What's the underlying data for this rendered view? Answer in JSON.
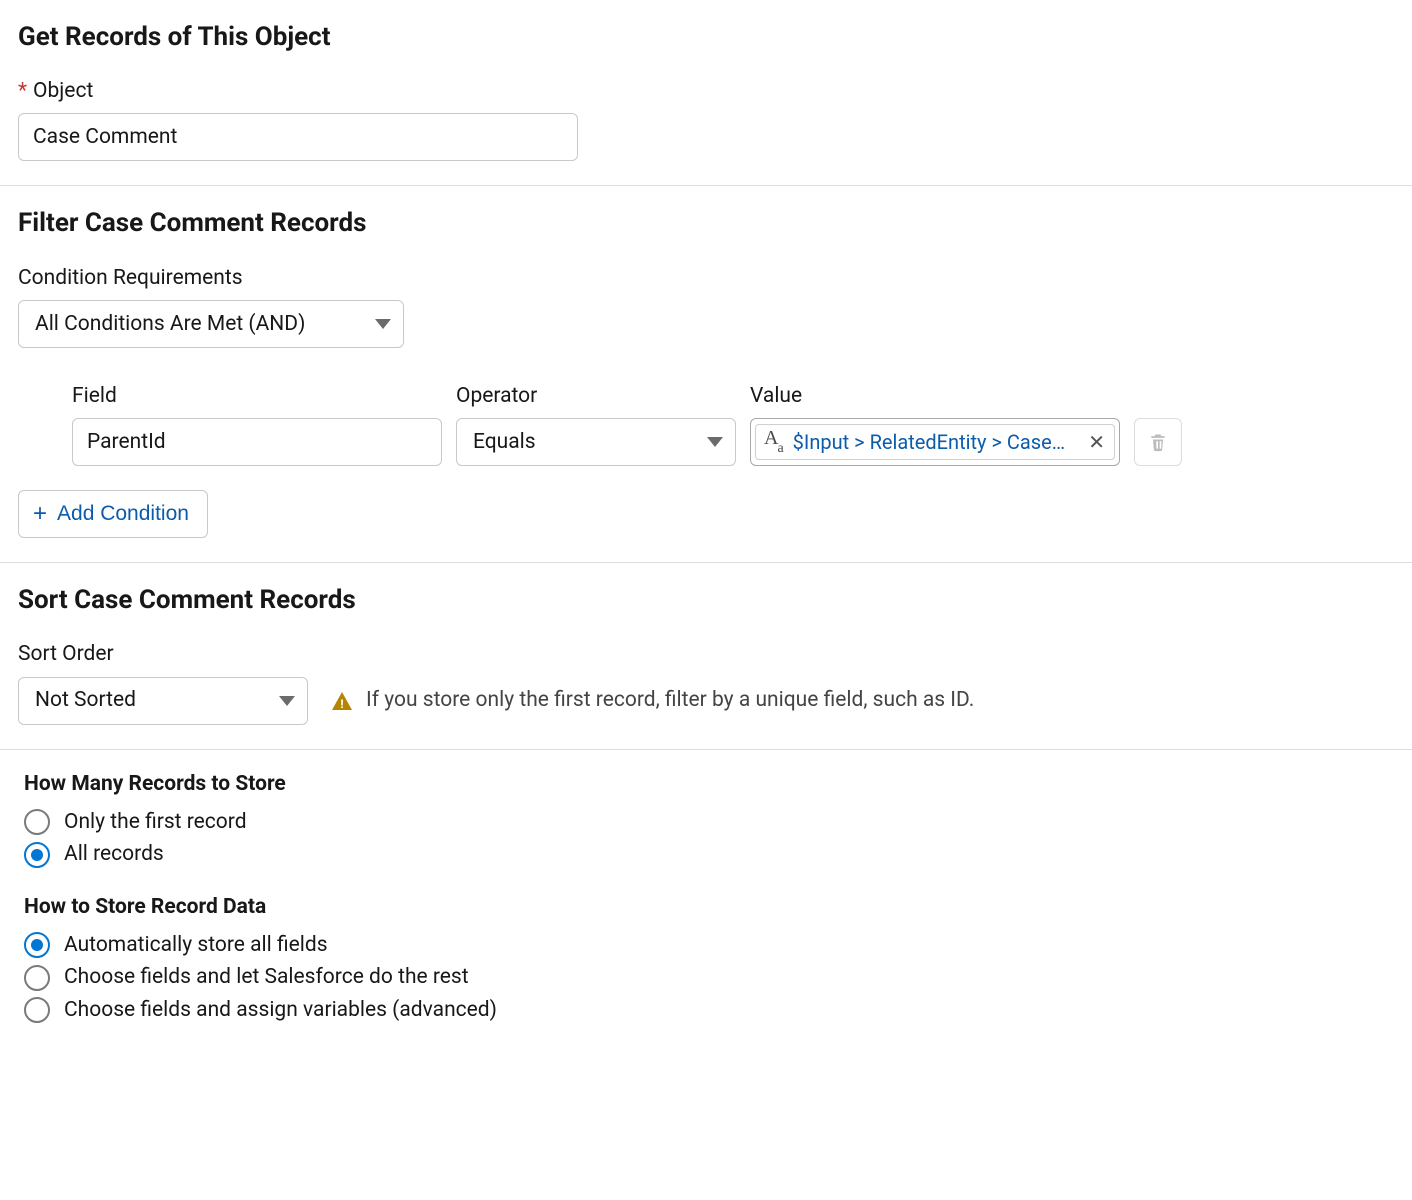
{
  "get_records": {
    "title": "Get Records of This Object",
    "object_label": "Object",
    "object_value": "Case Comment"
  },
  "filter": {
    "title": "Filter Case Comment Records",
    "cond_req_label": "Condition Requirements",
    "cond_req_value": "All Conditions Are Met (AND)",
    "row": {
      "field_label": "Field",
      "field_value": "ParentId",
      "operator_label": "Operator",
      "operator_value": "Equals",
      "value_label": "Value",
      "value_token": "$Input > RelatedEntity > Case…"
    },
    "add_condition": "Add Condition"
  },
  "sort": {
    "title": "Sort Case Comment Records",
    "sort_order_label": "Sort Order",
    "sort_order_value": "Not Sorted",
    "hint": "If you store only the first record, filter by a unique field, such as ID."
  },
  "store_count": {
    "title": "How Many Records to Store",
    "options": [
      "Only the first record",
      "All records"
    ],
    "selected": 1
  },
  "store_mode": {
    "title": "How to Store Record Data",
    "options": [
      "Automatically store all fields",
      "Choose fields and let Salesforce do the rest",
      "Choose fields and assign variables (advanced)"
    ],
    "selected": 0
  }
}
